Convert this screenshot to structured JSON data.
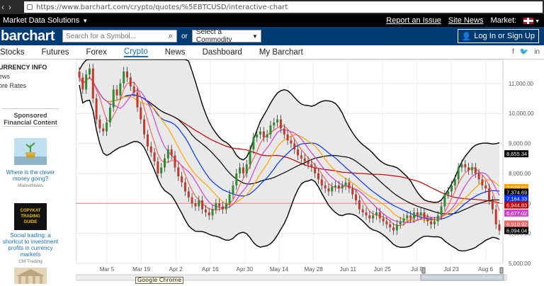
{
  "browser": {
    "url": "https://www.barchart.com/crypto/quotes/%5EBTCUSD/interactive-chart"
  },
  "topnav": {
    "market_data": "Market Data Solutions",
    "report": "Report an Issue",
    "site_news": "Site News",
    "market": "Market:"
  },
  "header": {
    "logo": "barchart",
    "search_placeholder": "Search for a Symbol...",
    "or": "or",
    "commodity": "Select a Commodity",
    "login": "Log In or Sign Up"
  },
  "menu": {
    "items": [
      "Stocks",
      "Futures",
      "Forex",
      "Crypto",
      "News",
      "Dashboard",
      "My Barchart"
    ],
    "active": "Crypto"
  },
  "sidebar": {
    "heading": "URRENCY INFO",
    "links": [
      "ews",
      "ore Rates"
    ],
    "sponsored": "Sponsored Financial Content",
    "ads": [
      {
        "title": "Where is the clever money going?",
        "source": "MarketNews"
      },
      {
        "title": "Social trading: a shortcut to investment profits in currency markets",
        "source": "CM Trading",
        "badge": "COPYKAT TRADING GUIDE"
      }
    ]
  },
  "tooltip": "Google Chrome",
  "chart_data": {
    "type": "candlestick",
    "symbol": "^BTCUSD",
    "ylim": [
      5000,
      11800
    ],
    "y_ticks": [
      5000,
      6000,
      7000,
      8000,
      9000,
      10000,
      11000
    ],
    "y_tick_labels": [
      "5,000.00",
      "6,000.00",
      "7,000.00",
      "8,000.00",
      "9,000.00",
      "10,000.00",
      "11,000.00"
    ],
    "x_labels": [
      "Mar 5",
      "Mar 19",
      "Apr 2",
      "Apr 16",
      "Apr 30",
      "May 14",
      "May 28",
      "Jun 11",
      "Jun 25",
      "Jul 9",
      "Jul 23",
      "Aug 6"
    ],
    "close": [
      11200,
      10800,
      11300,
      11500,
      10500,
      9800,
      9500,
      9400,
      9700,
      10200,
      10800,
      10600,
      11000,
      11400,
      11200,
      10900,
      10700,
      10200,
      9800,
      9300,
      8900,
      8700,
      8400,
      8000,
      8200,
      8500,
      8800,
      8600,
      8200,
      7900,
      7700,
      7400,
      7200,
      7000,
      6900,
      7100,
      6800,
      6700,
      6600,
      6800,
      7000,
      6900,
      6800,
      7000,
      7300,
      7600,
      8000,
      8200,
      8000,
      8300,
      8800,
      9200,
      9300,
      9400,
      9200,
      9300,
      9600,
      9700,
      9800,
      9500,
      9300,
      9100,
      9000,
      8800,
      8600,
      8500,
      8400,
      8300,
      8200,
      8000,
      7800,
      7600,
      7500,
      7400,
      7550,
      7600,
      7500,
      7600,
      7700,
      7500,
      7300,
      7100,
      6800,
      6700,
      6600,
      6500,
      6600,
      6700,
      6500,
      6400,
      6300,
      6200,
      6100,
      6300,
      6400,
      6500,
      6600,
      6500,
      6700,
      6600,
      6700,
      6500,
      6400,
      6300,
      6400,
      6600,
      6900,
      7300,
      7400,
      7600,
      7800,
      8200,
      8300,
      8200,
      8100,
      8200,
      8000,
      7800,
      7600,
      7500,
      7100,
      6800,
      6300,
      6094
    ],
    "indicators": [
      {
        "name": "Upper BB",
        "color": "#000000",
        "last_label": "8,655.34",
        "last_value": 8655
      },
      {
        "name": "MA 1",
        "color": "#ffa500",
        "last_label": "7,528.01",
        "last_value": 7528
      },
      {
        "name": "MA 2",
        "color": "#000000",
        "last_label": "7,374.69",
        "last_value": 7375
      },
      {
        "name": "MA 3",
        "color": "#0033ff",
        "last_label": "7,164.33",
        "last_value": 7164
      },
      {
        "name": "MA 4",
        "color": "#c00000",
        "last_label": "6,944.83",
        "last_value": 6945
      },
      {
        "name": "MA 5",
        "color": "#cc44cc",
        "last_label": "6,677.02",
        "last_value": 6677
      },
      {
        "name": "MA 6",
        "color": "#ee6666",
        "last_label": "6,310.92",
        "last_value": 6311
      },
      {
        "name": "Lower BB",
        "color": "#000000",
        "last_label": "6,094.04",
        "last_value": 6094
      }
    ],
    "grid": true
  }
}
